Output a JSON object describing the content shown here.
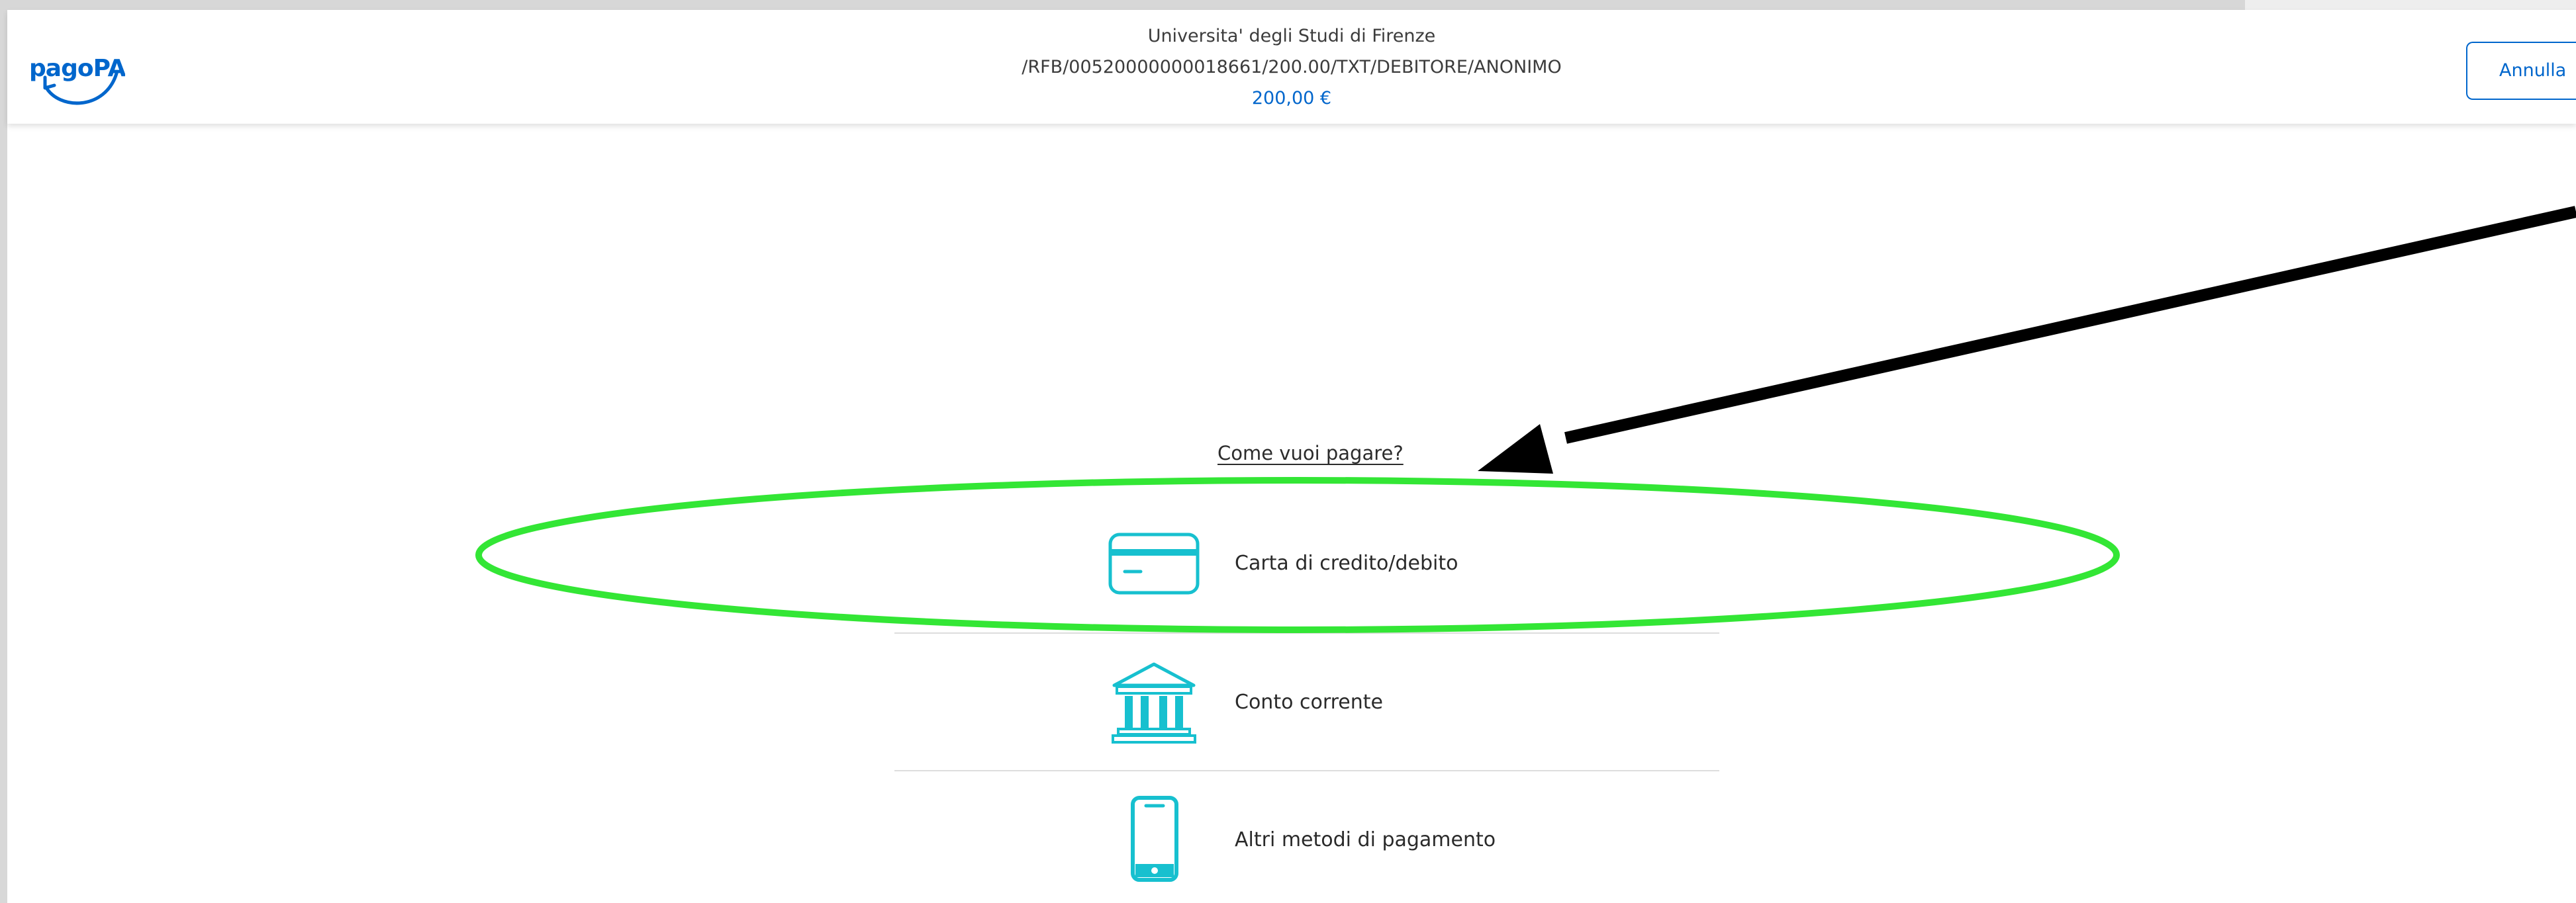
{
  "header": {
    "logo_text": "pagoPA",
    "merchant": "Universita' degli Studi di Firenze",
    "reference": "/RFB/00520000000018661/200.00/TXT/DEBITORE/ANONIMO",
    "amount": "200,00 €",
    "cancel_label": "Annulla"
  },
  "main": {
    "question": "Come vuoi pagare?",
    "methods": [
      {
        "label": "Carta di credito/debito",
        "icon": "credit-card-icon"
      },
      {
        "label": "Conto corrente",
        "icon": "bank-icon"
      },
      {
        "label": "Altri metodi di pagamento",
        "icon": "smartphone-icon"
      }
    ]
  },
  "annotations": {
    "highlight": "green-ellipse",
    "pointer": "black-arrow"
  },
  "colors": {
    "brand_blue": "#0066cc",
    "icon_teal": "#17c0cf",
    "highlight_green": "#33e635",
    "arrow_black": "#000000"
  }
}
